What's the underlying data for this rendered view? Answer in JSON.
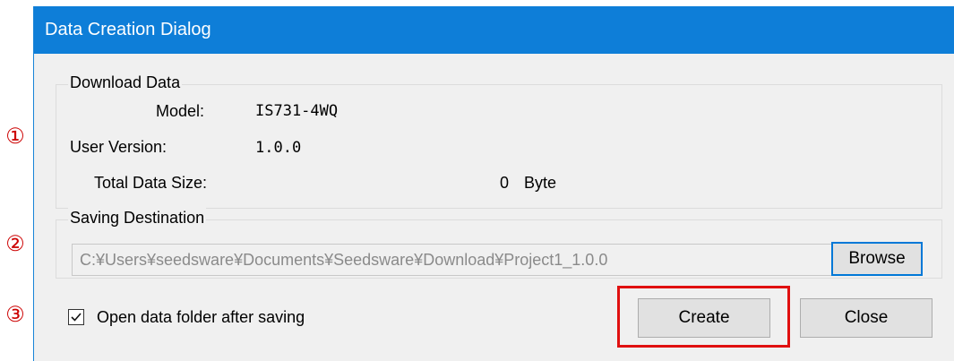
{
  "markers": [
    "①",
    "②",
    "③"
  ],
  "dialog": {
    "title": "Data Creation Dialog"
  },
  "download_data": {
    "legend": "Download Data",
    "model_label": "Model:",
    "model_value": "IS731-4WQ",
    "user_version_label": "User Version:",
    "user_version_value": "1.0.0",
    "total_size_label": "Total Data Size:",
    "total_size_value": "0",
    "total_size_unit": "Byte"
  },
  "saving_destination": {
    "legend": "Saving Destination",
    "path": "C:¥Users¥seedsware¥Documents¥Seedsware¥Download¥Project1_1.0.0",
    "browse_label": "Browse"
  },
  "options": {
    "open_folder_label": "Open data folder after saving",
    "open_folder_checked": true
  },
  "buttons": {
    "create_label": "Create",
    "close_label": "Close"
  },
  "colors": {
    "titlebar": "#0e7ed8",
    "marker": "#cc0000",
    "highlight": "#e01010",
    "focus_border": "#0078d7"
  }
}
